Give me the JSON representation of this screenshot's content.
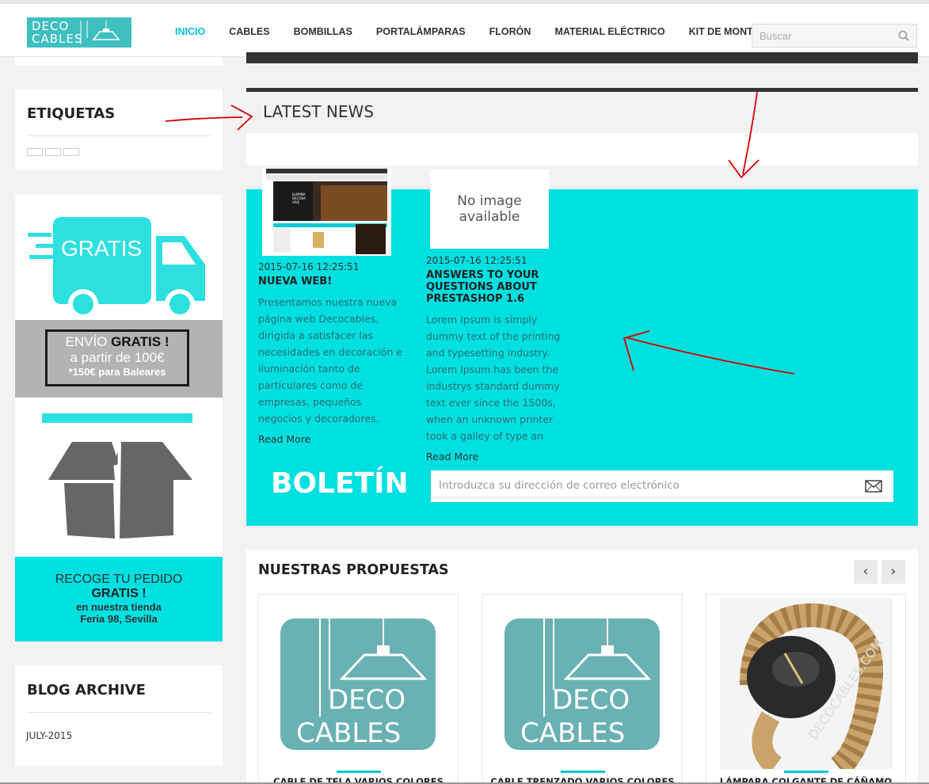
{
  "header": {
    "logo": {
      "line1": "DECO",
      "line2": "CABLES"
    },
    "nav": [
      "INICIO",
      "CABLES",
      "BOMBILLAS",
      "PORTALÁMPARAS",
      "FLORÓN",
      "MATERIAL ELÉCTRICO",
      "KIT DE MONTAJE"
    ],
    "active_nav": "INICIO",
    "search_placeholder": "Buscar"
  },
  "sidebar": {
    "tags_title": "ETIQUETAS",
    "promo": {
      "truck_text": "GRATIS",
      "shipping_line1_a": "ENVÍO",
      "shipping_line1_b": "GRATIS !",
      "shipping_line2": "a partir de 100€",
      "shipping_line3": "*150€ para Baleares",
      "pickup_line1": "RECOGE TU PEDIDO",
      "pickup_line2": "GRATIS !",
      "pickup_line3": "en nuestra tienda",
      "pickup_line4": "Feria 98, Sevilla"
    },
    "archive_title": "BLOG ARCHIVE",
    "archive_items": [
      "JULY-2015"
    ]
  },
  "news": {
    "title": "LATEST NEWS",
    "posts": [
      {
        "date": "2015-07-16 12:25:51",
        "title": "NUEVA WEB!",
        "body": [
          "Presentamos nuestra nueva",
          "página web Decocables,",
          "dirigida a satisfacer las",
          "necesidades en decoración e",
          "iluminación tanto de",
          "particulares como de",
          "empresas, pequeños",
          "negocios y decoradores."
        ],
        "more": "Read More"
      },
      {
        "date": "2015-07-16 12:25:51",
        "title_lines": [
          "ANSWERS TO YOUR",
          "QUESTIONS ABOUT",
          "PRESTASHOP 1.6"
        ],
        "body": [
          "Lorem Ipsum is simply",
          "dummy text of the printing",
          "and typesetting industry.",
          "Lorem Ipsum has been the",
          "industrys standard dummy",
          "text ever since the 1500s,",
          "when an unknown printer",
          "took a galley of type an"
        ],
        "more": "Read More",
        "no_image_line1": "No image",
        "no_image_line2": "available"
      }
    ],
    "thumb_text": "ILUMINA DECORA VIVE"
  },
  "newsletter": {
    "title": "BOLETÍN",
    "placeholder": "Introduzca su dirección de correo electrónico"
  },
  "propuestas": {
    "title": "NUESTRAS PROPUESTAS",
    "prev": "‹",
    "next": "›",
    "products": [
      {
        "name": "CABLE DE TELA VARIOS COLORES"
      },
      {
        "name": "CABLE TRENZADO VARIOS COLORES"
      },
      {
        "name": "LÁMPARA COLGANTE DE CÁÑAMO"
      }
    ],
    "watermark": "DECOCABLES.COM"
  },
  "colors": {
    "accent": "#00e0e0",
    "nav_active": "#00c2d8",
    "logo_bg": "#3fbfbf",
    "product_logo_bg": "#6ab1b3",
    "annotation": "#d40000"
  }
}
